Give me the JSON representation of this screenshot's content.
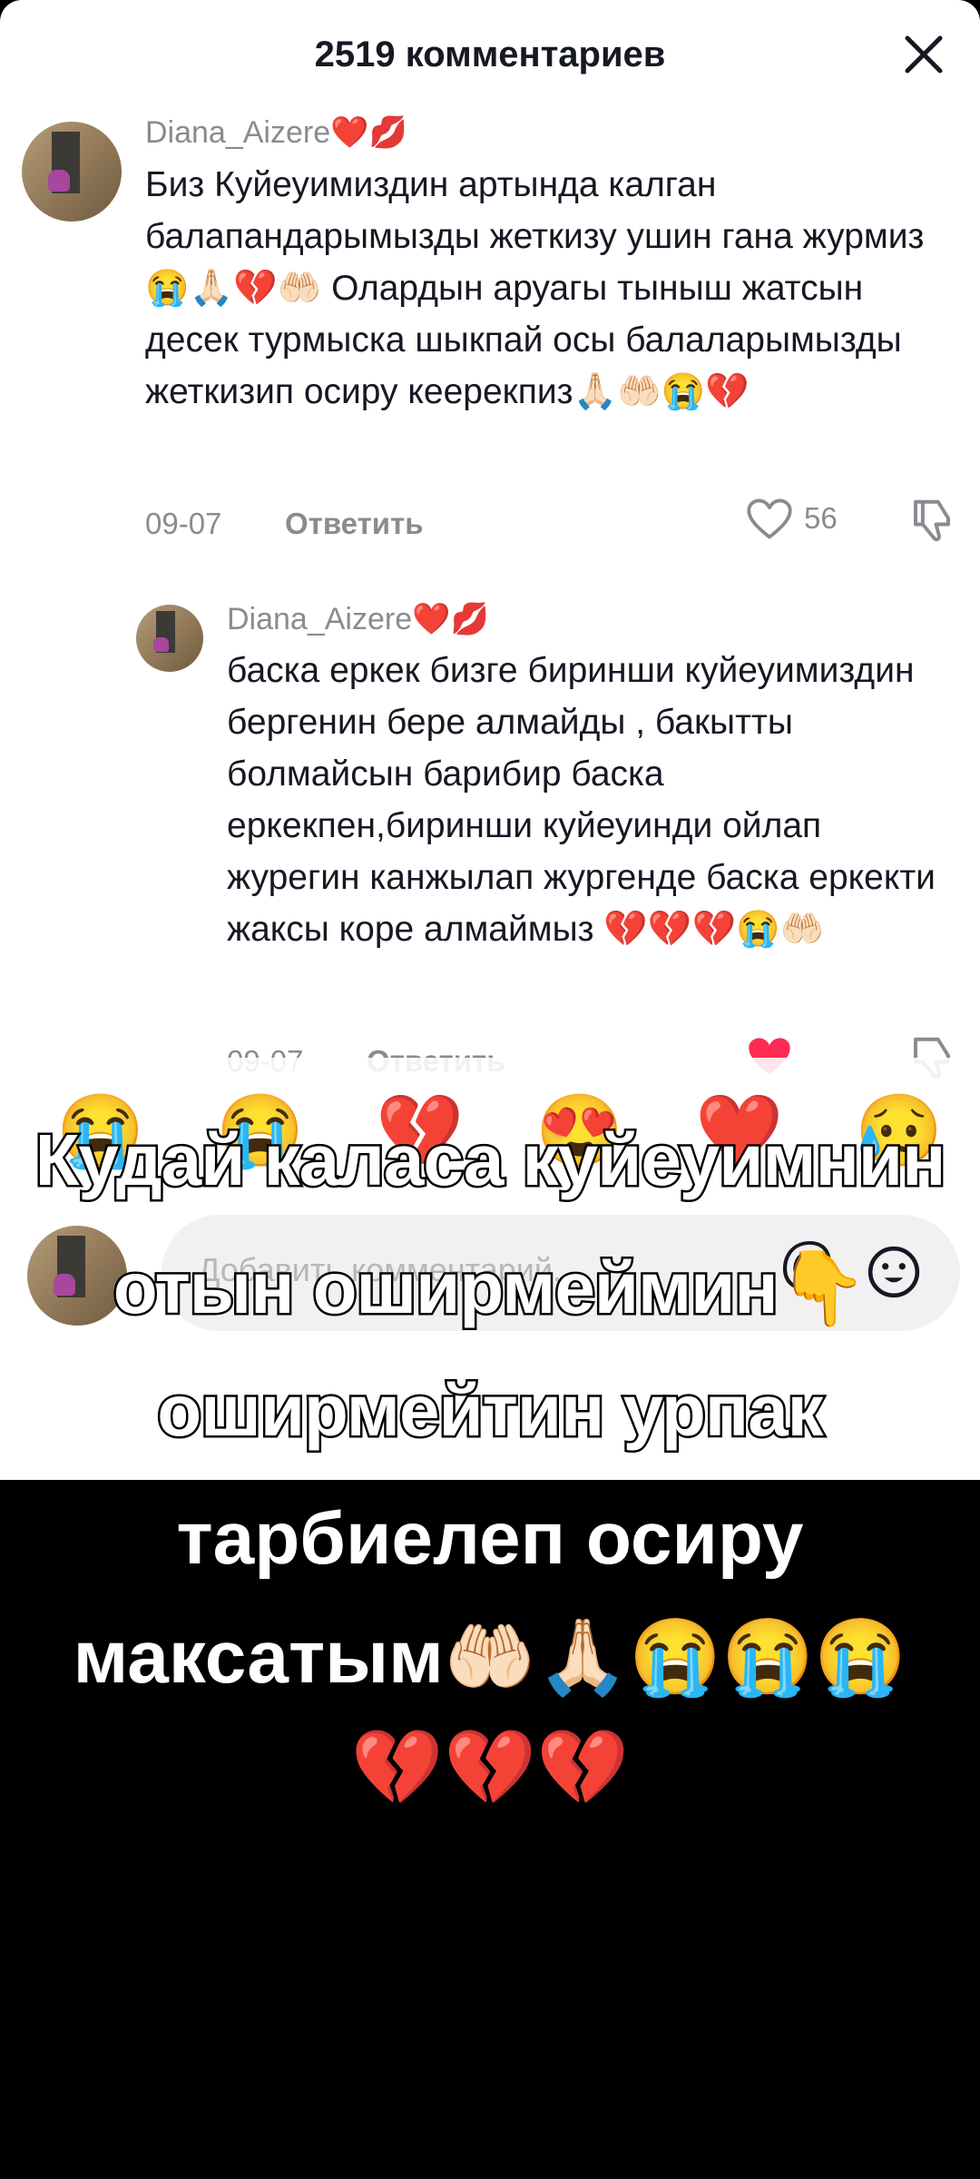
{
  "header": {
    "title": "2519 комментариев"
  },
  "comments": [
    {
      "username": "Diana_Aizere❤️💋",
      "text": "Биз Куйеуимиздин артында калган балапандарымызды жеткизу ушин гана журмиз 😭🙏🏻💔🤲🏻 Олардын аруагы тыныш жатсын десек турмыска шыкпай осы балаларымызды жеткизип осиру кеерекпиз🙏🏻🤲🏻😭💔",
      "date": "09-07",
      "reply_label": "Ответить",
      "like_count": "56"
    },
    {
      "username": "Diana_Aizere❤️💋",
      "text": "баска еркек бизге биринши куйеуимиздин бергенин бере алмайды , бакытты болмайсын барибир баска еркекпен,биринши куйеуинди ойлап журегин канжылап жургенде баска еркекти жаксы коре алмаймыз 💔💔💔😭🤲🏻",
      "date": "09-07",
      "reply_label": "Ответить"
    }
  ],
  "emoji_bar": [
    "😭",
    "😭",
    "💔",
    "😍",
    "❤️",
    "😥"
  ],
  "input": {
    "placeholder": "Добавить комментарий..."
  },
  "caption": {
    "line1": "Кудай каласа куйеуимнин",
    "line2": "отын оширмеймин👇",
    "line3": "оширмейтин урпак",
    "line4": "тарбиелеп осиру",
    "line5": "максатым🤲🏻🙏🏻😭😭😭",
    "line6": "💔💔💔"
  }
}
